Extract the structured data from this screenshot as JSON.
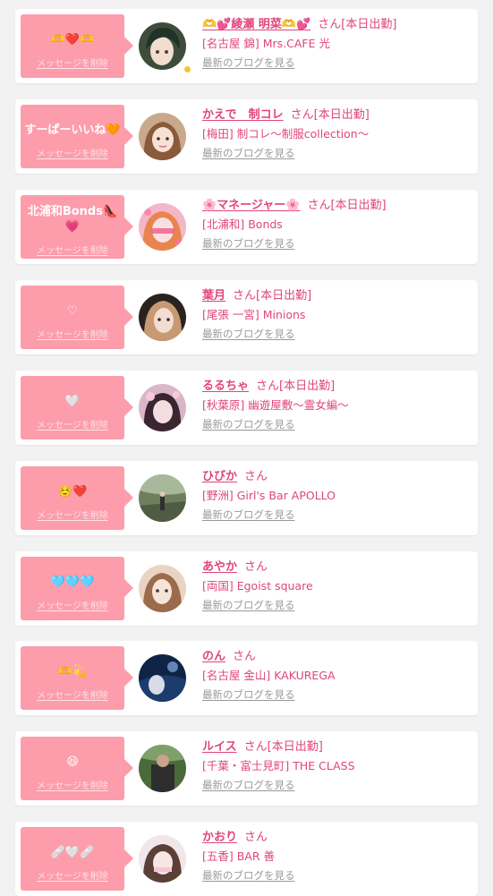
{
  "delete_label": "メッセージを削除",
  "blog_label": "最新のブログを見る",
  "san": "さん",
  "cards": [
    {
      "message": "🫶❤️🫶",
      "name": "🫶💕綾瀬 明菜🫶💕",
      "badge": "[本日出勤]",
      "shop": "[名古屋 錦] Mrs.CAFE 光"
    },
    {
      "message": "すーぱーいいね🧡",
      "name": "かえで　制コレ",
      "badge": "[本日出勤]",
      "shop": "[梅田] 制コレ〜制服collection〜"
    },
    {
      "message": "北浦和Bonds👠💗",
      "name": "🌸マネージャー🌸",
      "badge": "[本日出勤]",
      "shop": "[北浦和] Bonds"
    },
    {
      "message": "♡",
      "name": "葉月",
      "badge": "[本日出勤]",
      "shop": "[尾張 一宮] Minions"
    },
    {
      "message": "🤍",
      "name": "るるちゃ",
      "badge": "[本日出勤]",
      "shop": "[秋葉原] 幽遊屋敷〜霊女編〜"
    },
    {
      "message": "☺️❤️",
      "name": "ひびか",
      "badge": "",
      "shop": "[野洲] Girl's Bar APOLLO"
    },
    {
      "message": "🩵🩵🩵",
      "name": "あやか",
      "badge": "",
      "shop": "[両国] Egoist square"
    },
    {
      "message": "🫶💫",
      "name": "のん",
      "badge": "",
      "shop": "[名古屋 金山] KAKUREGA"
    },
    {
      "message": "😆",
      "name": "ルイス",
      "badge": "[本日出勤]",
      "shop": "[千葉・富士見町] THE CLASS"
    },
    {
      "message": "🩹🤍🩹",
      "name": "かおり",
      "badge": "",
      "shop": "[五香] BAR 善"
    }
  ],
  "colors": {
    "bubble": "#fd9cab",
    "accent": "#e0457c",
    "muted": "#9a9a9a",
    "background": "#f2f2f2"
  }
}
